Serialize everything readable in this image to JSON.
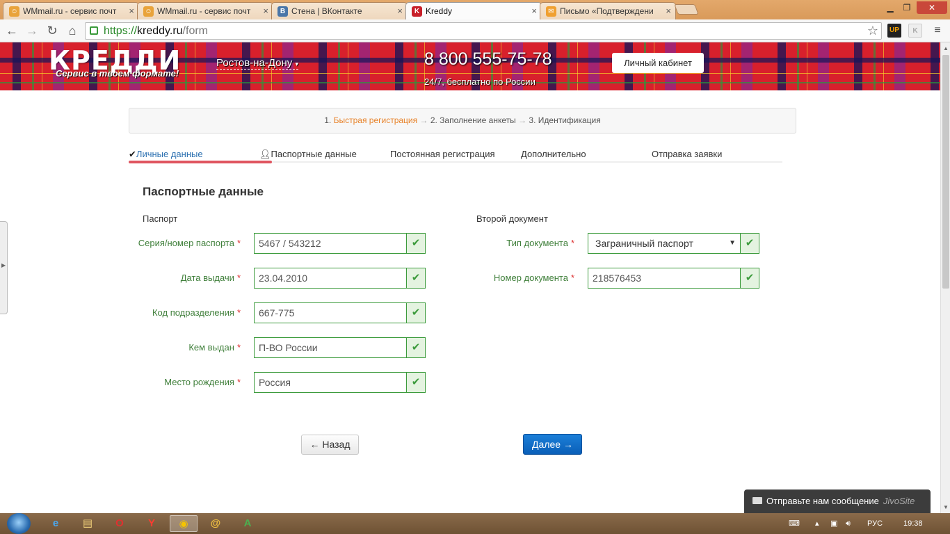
{
  "browser": {
    "tabs": [
      {
        "label": "WMmail.ru - сервис почт",
        "icon": "wmmail-icon",
        "active": false
      },
      {
        "label": "WMmail.ru - сервис почт",
        "icon": "wmmail-icon",
        "active": false
      },
      {
        "label": "Стена | ВКонтакте",
        "icon": "vk-icon",
        "active": false
      },
      {
        "label": "Kreddy",
        "icon": "kreddy-icon",
        "active": true
      },
      {
        "label": "Письмо «Подтверждени",
        "icon": "mail-icon",
        "active": false
      }
    ],
    "url_scheme": "https://",
    "url_host": "kreddy.ru",
    "url_path": "/form"
  },
  "header": {
    "logo": "КРЕДДИ",
    "tagline": "Сервис в твоем формате!",
    "city": "Ростов-на-Дону",
    "phone": "8 800 555-75-78",
    "phone_note": "24/7, бесплатно по России",
    "cabinet_label": "Личный кабинет"
  },
  "steps": {
    "step1": "1.",
    "step1_label": "Быстрая регистрация",
    "step2": "2. Заполнение анкеты",
    "step3": "3. Идентификация"
  },
  "subtabs": [
    {
      "label": "Личные данные",
      "state": "done"
    },
    {
      "label": "Паспортные данные",
      "state": "current"
    },
    {
      "label": "Постоянная регистрация",
      "state": "pending"
    },
    {
      "label": "Дополнительно",
      "state": "pending"
    },
    {
      "label": "Отправка заявки",
      "state": "pending"
    }
  ],
  "form_progress": 0.2,
  "form": {
    "title": "Паспортные данные",
    "passport_group": "Паспорт",
    "second_group": "Второй документ",
    "required_mark": "*",
    "passport_fields": [
      {
        "label": "Серия/номер паспорта",
        "value": "5467 / 543212"
      },
      {
        "label": "Дата выдачи",
        "value": "23.04.2010"
      },
      {
        "label": "Код подразделения",
        "value": "667-775"
      },
      {
        "label": "Кем выдан",
        "value": "П-ВО России"
      },
      {
        "label": "Место рождения",
        "value": "Россия"
      }
    ],
    "second_fields": [
      {
        "label": "Тип документа",
        "value": "Заграничный паспорт"
      },
      {
        "label": "Номер документа",
        "value": "218576453"
      }
    ],
    "back_label": "← Назад",
    "next_label": "Далее →"
  },
  "jivo": {
    "message": "Отправьте нам сообщение",
    "brand": "JivoSite"
  },
  "taskbar": {
    "language": "РУС",
    "time": "19:38"
  },
  "colors": {
    "accent_orange": "#e8842c",
    "valid_green": "#3c9b3c",
    "primary_blue": "#0a5fb8",
    "progress_red": "#e05560"
  }
}
